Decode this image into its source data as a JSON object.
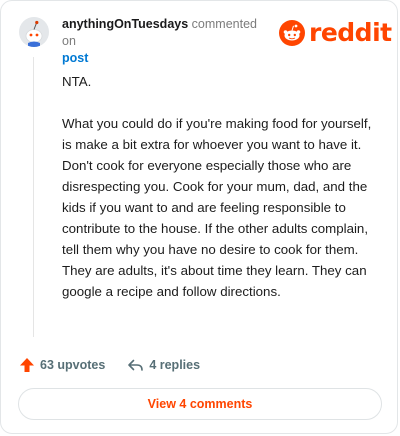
{
  "comment": {
    "username": "anythingOnTuesdays",
    "action_text": "commented on",
    "post_link": "post",
    "paragraphs": [
      "NTA.",
      "What you could do if you're making food for yourself, is make a bit extra for whoever you want to have it. Don't cook for everyone especially those who are disrespecting you. Cook for your mum, dad, and the kids if you want to and are feeling responsible to contribute to the house. If the other adults complain, tell them why you have no desire to cook for them. They are adults, it's about time they learn. They can google a recipe and follow directions."
    ],
    "upvotes": "63 upvotes",
    "replies": "4 replies"
  },
  "brand": {
    "logo_text": "reddit",
    "color": "#ff4500"
  },
  "footer": {
    "view_comments_label": "View 4 comments"
  },
  "icons": {
    "avatar": "snoo-avatar-icon",
    "logo": "reddit-snoo-icon",
    "upvote": "upvote-arrow-icon",
    "reply": "reply-arrow-icon"
  }
}
